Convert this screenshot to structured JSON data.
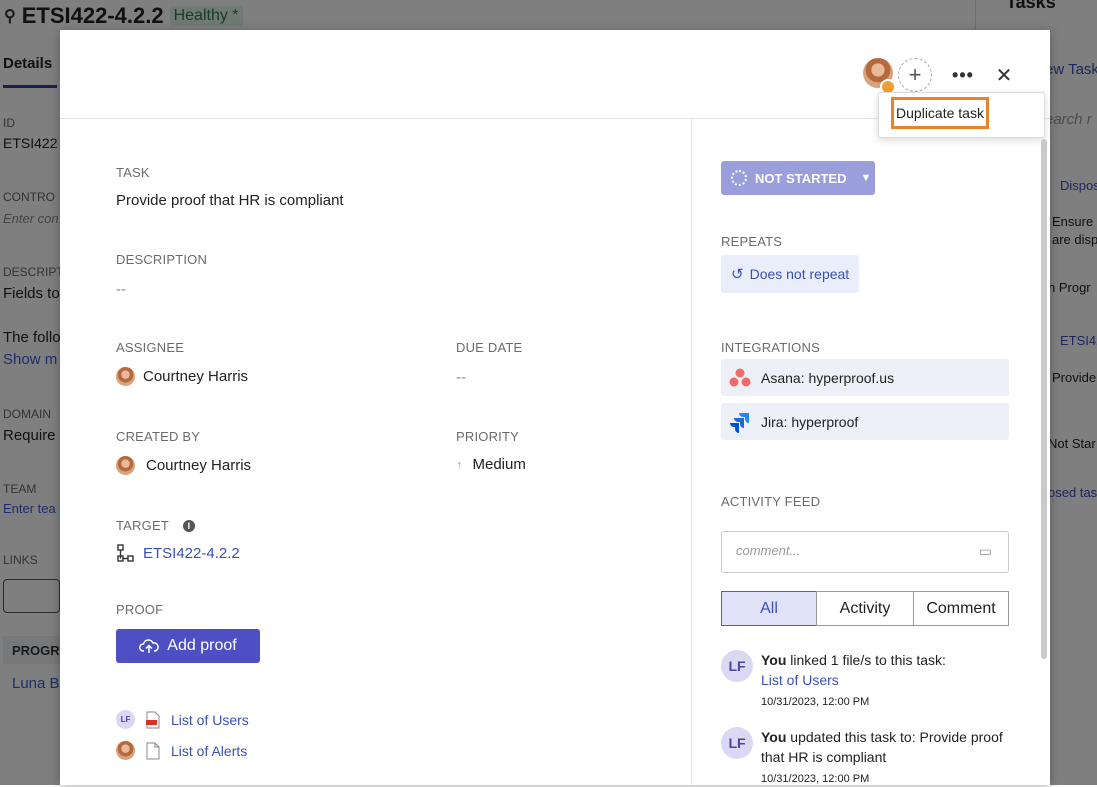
{
  "background": {
    "title": "ETSI422-4.2.2",
    "health": "Healthy *",
    "tab": "Details",
    "fields": {
      "id_label": "ID",
      "id_value": "ETSI422",
      "control_label": "CONTRO",
      "control_placeholder": "Enter con",
      "description_label": "DESCRIPT",
      "description_line1": "Fields to",
      "description_line2": "The follo",
      "show_more": "Show m",
      "domain_label": "DOMAIN",
      "domain_value": "Require",
      "team_label": "TEAM",
      "team_placeholder": "Enter tea",
      "links_label": "LINKS",
      "programs_header": "PROGRA",
      "program_item": "Luna B"
    },
    "right_panel": {
      "title": "Tasks",
      "new_task": "ew Task",
      "search": "earch r",
      "item1": "Dispos",
      "item2a": "Ensure",
      "item2b": "are disp",
      "item3": "n Progr",
      "item4": "ETSI42",
      "item5": "Provide",
      "item6": "Not Star",
      "item7": "osed tas"
    }
  },
  "modal": {
    "header": {
      "more_label": "•••",
      "close_label": "✕",
      "add_label": "+",
      "menu_item": "Duplicate task"
    },
    "task": {
      "label": "TASK",
      "value": "Provide proof that HR is compliant"
    },
    "description": {
      "label": "DESCRIPTION",
      "value": "--"
    },
    "assignee": {
      "label": "ASSIGNEE",
      "value": "Courtney Harris"
    },
    "due_date": {
      "label": "DUE DATE",
      "value": "--"
    },
    "created_by": {
      "label": "CREATED BY",
      "value": "Courtney Harris"
    },
    "priority": {
      "label": "PRIORITY",
      "value": "Medium",
      "color": "#f0a030"
    },
    "target": {
      "label": "TARGET",
      "value": "ETSI422-4.2.2"
    },
    "proof": {
      "label": "PROOF",
      "add_button": "Add proof",
      "items": [
        {
          "avatar": "LF",
          "name": "List of Users",
          "type": "pdf"
        },
        {
          "avatar": "photo",
          "name": "List of Alerts",
          "type": "file"
        }
      ]
    },
    "status": {
      "value": "NOT STARTED"
    },
    "repeats": {
      "label": "REPEATS",
      "value": "Does not repeat"
    },
    "integrations": {
      "label": "INTEGRATIONS",
      "items": [
        {
          "name": "Asana: hyperproof.us",
          "icon": "asana-icon"
        },
        {
          "name": "Jira: hyperproof",
          "icon": "jira-icon"
        }
      ]
    },
    "activity": {
      "label": "ACTIVITY FEED",
      "comment_placeholder": "comment...",
      "filters": [
        "All",
        "Activity",
        "Comment"
      ],
      "active_filter": "All",
      "entries": [
        {
          "avatar": "LF",
          "actor": "You",
          "text": " linked 1 file/s to this task:",
          "link": "List of Users",
          "timestamp": "10/31/2023, 12:00 PM"
        },
        {
          "avatar": "LF",
          "actor": "You",
          "text": " updated this task to: Provide proof that HR is compliant",
          "link": "",
          "timestamp": "10/31/2023, 12:00 PM"
        }
      ]
    }
  },
  "colors": {
    "accent": "#4f4fc4",
    "status": "#9a9fdc",
    "highlight": "#e8822c",
    "link": "#3b4fb8"
  }
}
